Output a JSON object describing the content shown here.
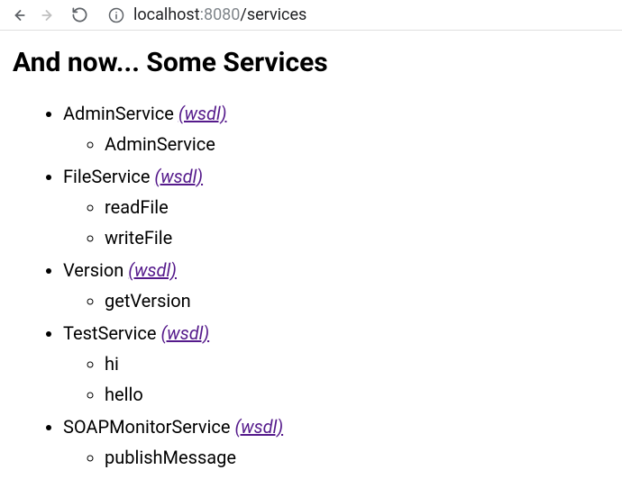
{
  "toolbar": {
    "url_host": "localhost",
    "url_port": ":8080",
    "url_path": "/services"
  },
  "page": {
    "heading": "And now... Some Services"
  },
  "services": [
    {
      "name": "AdminService",
      "wsdl_label": "(wsdl)",
      "methods": [
        "AdminService"
      ]
    },
    {
      "name": "FileService",
      "wsdl_label": "(wsdl)",
      "methods": [
        "readFile",
        "writeFile"
      ]
    },
    {
      "name": "Version",
      "wsdl_label": "(wsdl)",
      "methods": [
        "getVersion"
      ]
    },
    {
      "name": "TestService",
      "wsdl_label": "(wsdl)",
      "methods": [
        "hi",
        "hello"
      ]
    },
    {
      "name": "SOAPMonitorService",
      "wsdl_label": "(wsdl)",
      "methods": [
        "publishMessage"
      ]
    }
  ]
}
